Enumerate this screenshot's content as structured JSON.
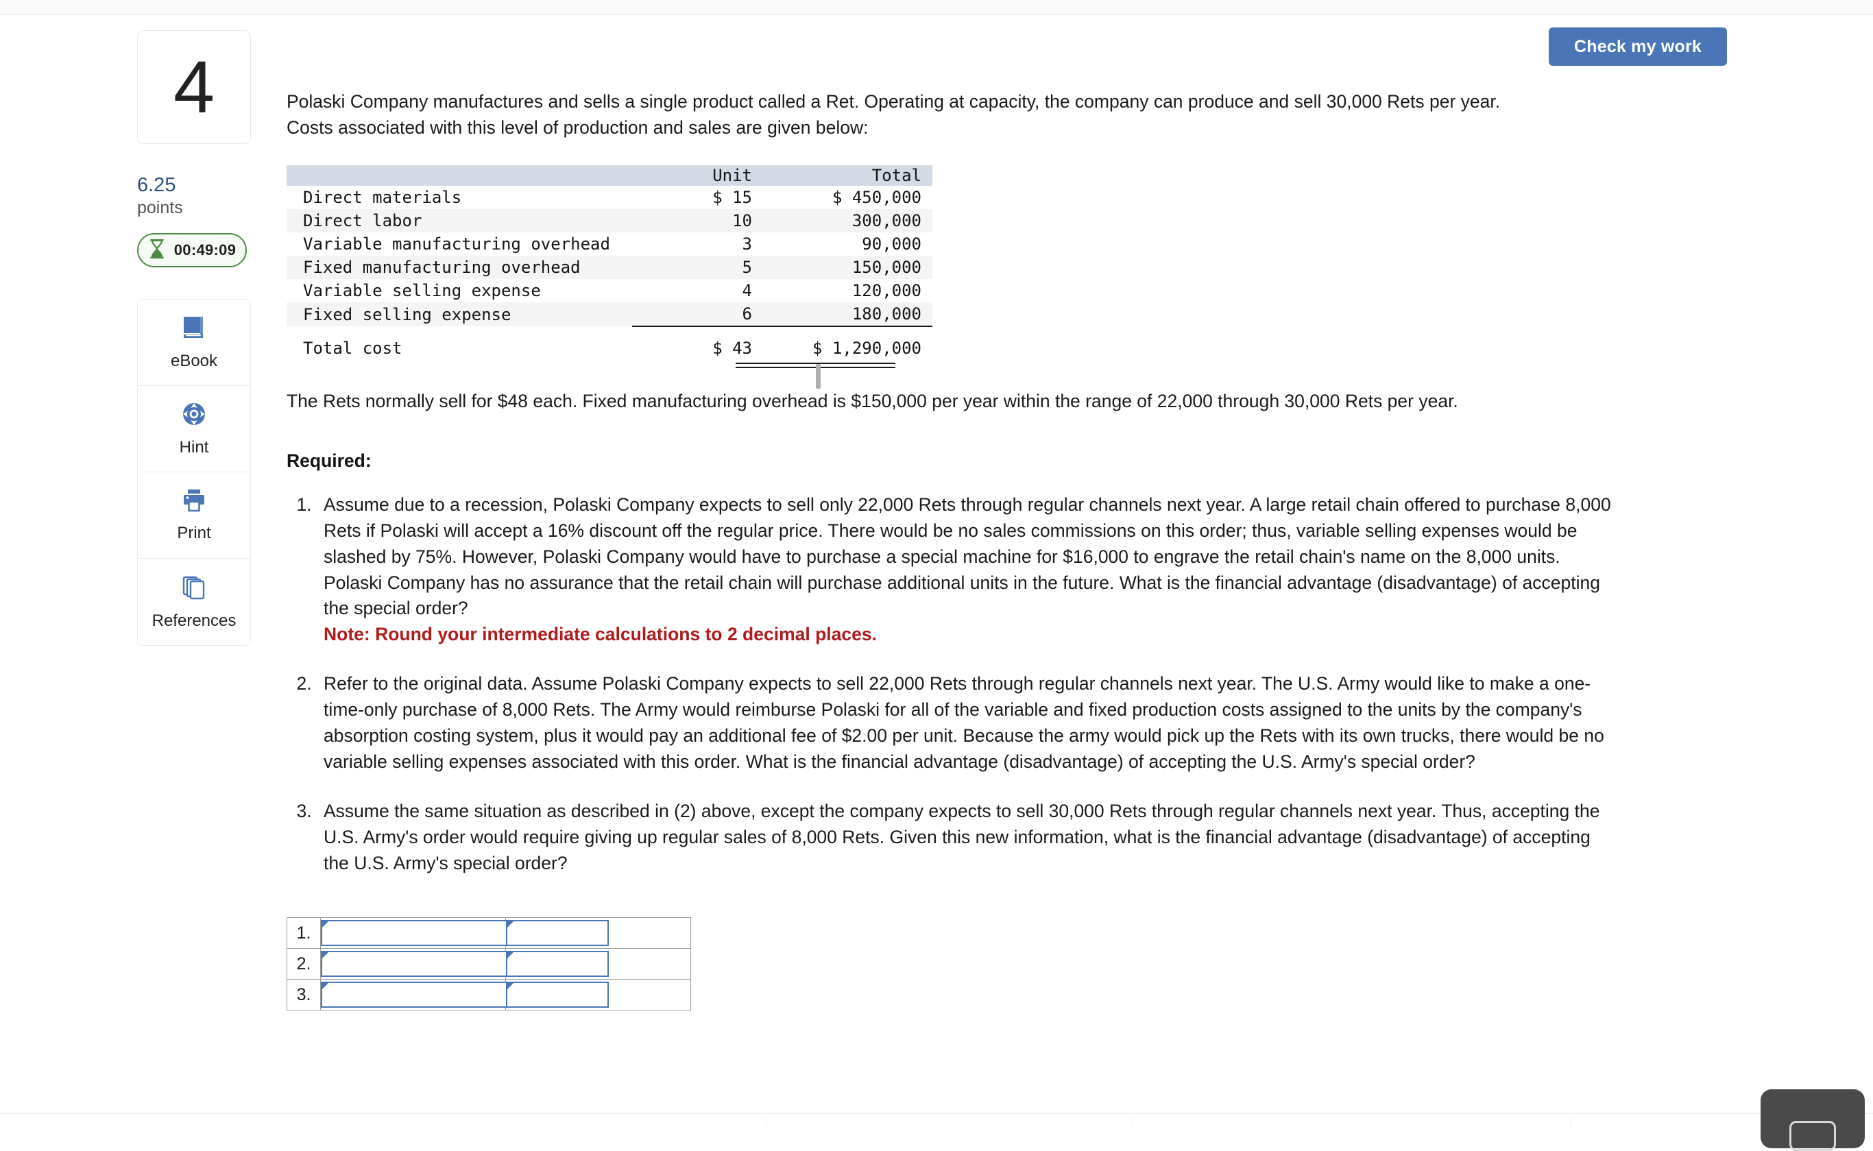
{
  "header": {
    "check_button_label": "Check my work"
  },
  "rail": {
    "question_number": "4",
    "points_value": "6.25",
    "points_label": "points",
    "timer_value": "00:49:09",
    "timer_icon": "hourglass-icon",
    "tools": [
      {
        "label": "eBook",
        "icon": "book-icon"
      },
      {
        "label": "Hint",
        "icon": "lifebuoy-icon"
      },
      {
        "label": "Print",
        "icon": "printer-icon"
      },
      {
        "label": "References",
        "icon": "copy-pages-icon"
      }
    ]
  },
  "main": {
    "intro": "Polaski Company manufactures and sells a single product called a Ret. Operating at capacity, the company can produce and sell 30,000 Rets per year. Costs associated with this level of production and sales are given below:",
    "selling_info": "The Rets normally sell for $48 each. Fixed manufacturing overhead is $150,000 per year within the range of 22,000 through 30,000 Rets per year.",
    "required_heading": "Required:",
    "requirements": [
      {
        "text": "Assume due to a recession, Polaski Company expects to sell only 22,000 Rets through regular channels next year. A large retail chain offered to purchase 8,000 Rets if Polaski will accept a 16% discount off the regular price. There would be no sales commissions on this order; thus, variable selling expenses would be slashed by 75%. However, Polaski Company would have to purchase a special machine for $16,000 to engrave the retail chain's name on the 8,000 units. Polaski Company has no assurance that the retail chain will purchase additional units in the future. What is the financial advantage (disadvantage) of accepting the special order?",
        "note": "Note: Round your intermediate calculations to 2 decimal places."
      },
      {
        "text": "Refer to the original data. Assume Polaski Company expects to sell 22,000 Rets through regular channels next year. The U.S. Army would like to make a one-time-only purchase of 8,000 Rets. The Army would reimburse Polaski for all of the variable and fixed production costs assigned to the units by the company's absorption costing system, plus it would pay an additional fee of $2.00 per unit. Because the army would pick up the Rets with its own trucks, there would be no variable selling expenses associated with this order. What is the financial advantage (disadvantage) of accepting the U.S. Army's special order?",
        "note": ""
      },
      {
        "text": "Assume the same situation as described in (2) above, except the company expects to sell 30,000 Rets through regular channels next year. Thus, accepting the U.S. Army's order would require giving up regular sales of 8,000 Rets. Given this new information, what is the financial advantage (disadvantage) of accepting the U.S. Army's special order?",
        "note": ""
      }
    ]
  },
  "cost_table": {
    "columns": [
      "",
      "Unit",
      "Total"
    ],
    "rows": [
      {
        "label": "Direct materials",
        "unit": "$ 15",
        "total": "$ 450,000"
      },
      {
        "label": "Direct labor",
        "unit": "10",
        "total": "300,000"
      },
      {
        "label": "Variable manufacturing overhead",
        "unit": "3",
        "total": "90,000"
      },
      {
        "label": "Fixed manufacturing overhead",
        "unit": "5",
        "total": "150,000"
      },
      {
        "label": "Variable selling expense",
        "unit": "4",
        "total": "120,000"
      },
      {
        "label": "Fixed selling expense",
        "unit": "6",
        "total": "180,000"
      }
    ],
    "total_row": {
      "label": "Total cost",
      "unit": "$ 43",
      "total": "$ 1,290,000"
    }
  },
  "answer_table": {
    "rows": [
      {
        "index": "1.",
        "value1": "",
        "value2": ""
      },
      {
        "index": "2.",
        "value1": "",
        "value2": ""
      },
      {
        "index": "3.",
        "value1": "",
        "value2": ""
      }
    ]
  },
  "colors": {
    "accent_blue": "#4A76B8",
    "points_blue": "#2e4f7d",
    "timer_green": "#4c8a43",
    "note_red": "#b01b1b",
    "table_header_bg": "#d3d9e5"
  }
}
